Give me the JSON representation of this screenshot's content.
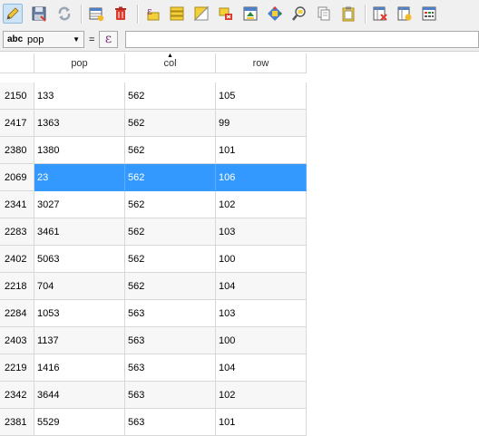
{
  "toolbar": {
    "buttons": [
      {
        "name": "toggle-editing-button",
        "icon": "pencil-icon",
        "active": true
      },
      {
        "name": "save-edits-button",
        "icon": "save-icon"
      },
      {
        "name": "reload-button",
        "icon": "reload-icon"
      },
      {
        "name": "add-feature-button",
        "icon": "add-row-icon"
      },
      {
        "name": "delete-selected-button",
        "icon": "trash-icon"
      },
      {
        "name": "select-by-expression-button",
        "icon": "expression-select-icon"
      },
      {
        "name": "select-all-button",
        "icon": "select-all-icon"
      },
      {
        "name": "invert-selection-button",
        "icon": "invert-selection-icon"
      },
      {
        "name": "deselect-all-button",
        "icon": "deselect-icon"
      },
      {
        "name": "move-selection-to-top-button",
        "icon": "move-top-icon"
      },
      {
        "name": "pan-to-selected-button",
        "icon": "pan-icon"
      },
      {
        "name": "zoom-to-selected-button",
        "icon": "zoom-icon"
      },
      {
        "name": "copy-rows-button",
        "icon": "copy-icon"
      },
      {
        "name": "paste-rows-button",
        "icon": "paste-icon"
      },
      {
        "name": "delete-field-button",
        "icon": "delete-field-icon"
      },
      {
        "name": "new-field-button",
        "icon": "new-field-icon"
      },
      {
        "name": "field-calculator-button",
        "icon": "calculator-icon"
      }
    ]
  },
  "expression_bar": {
    "field_type": "abc",
    "field_name": "pop",
    "equals": "=",
    "expression_value": ""
  },
  "table": {
    "columns": [
      "pop",
      "col",
      "row"
    ],
    "sorted_column_index": 1,
    "rows": [
      {
        "id": "2150",
        "pop": "133",
        "col": "562",
        "row": "105"
      },
      {
        "id": "2417",
        "pop": "1363",
        "col": "562",
        "row": "99"
      },
      {
        "id": "2380",
        "pop": "1380",
        "col": "562",
        "row": "101"
      },
      {
        "id": "2069",
        "pop": "23",
        "col": "562",
        "row": "106",
        "selected": true
      },
      {
        "id": "2341",
        "pop": "3027",
        "col": "562",
        "row": "102"
      },
      {
        "id": "2283",
        "pop": "3461",
        "col": "562",
        "row": "103"
      },
      {
        "id": "2402",
        "pop": "5063",
        "col": "562",
        "row": "100"
      },
      {
        "id": "2218",
        "pop": "704",
        "col": "562",
        "row": "104"
      },
      {
        "id": "2284",
        "pop": "1053",
        "col": "563",
        "row": "103"
      },
      {
        "id": "2403",
        "pop": "1137",
        "col": "563",
        "row": "100"
      },
      {
        "id": "2219",
        "pop": "1416",
        "col": "563",
        "row": "104"
      },
      {
        "id": "2342",
        "pop": "3644",
        "col": "563",
        "row": "102"
      },
      {
        "id": "2381",
        "pop": "5529",
        "col": "563",
        "row": "101"
      }
    ]
  },
  "colors": {
    "selection": "#3399ff",
    "grid_line": "#d8d8d8",
    "toolbar_bg": "#f0f0f0"
  }
}
